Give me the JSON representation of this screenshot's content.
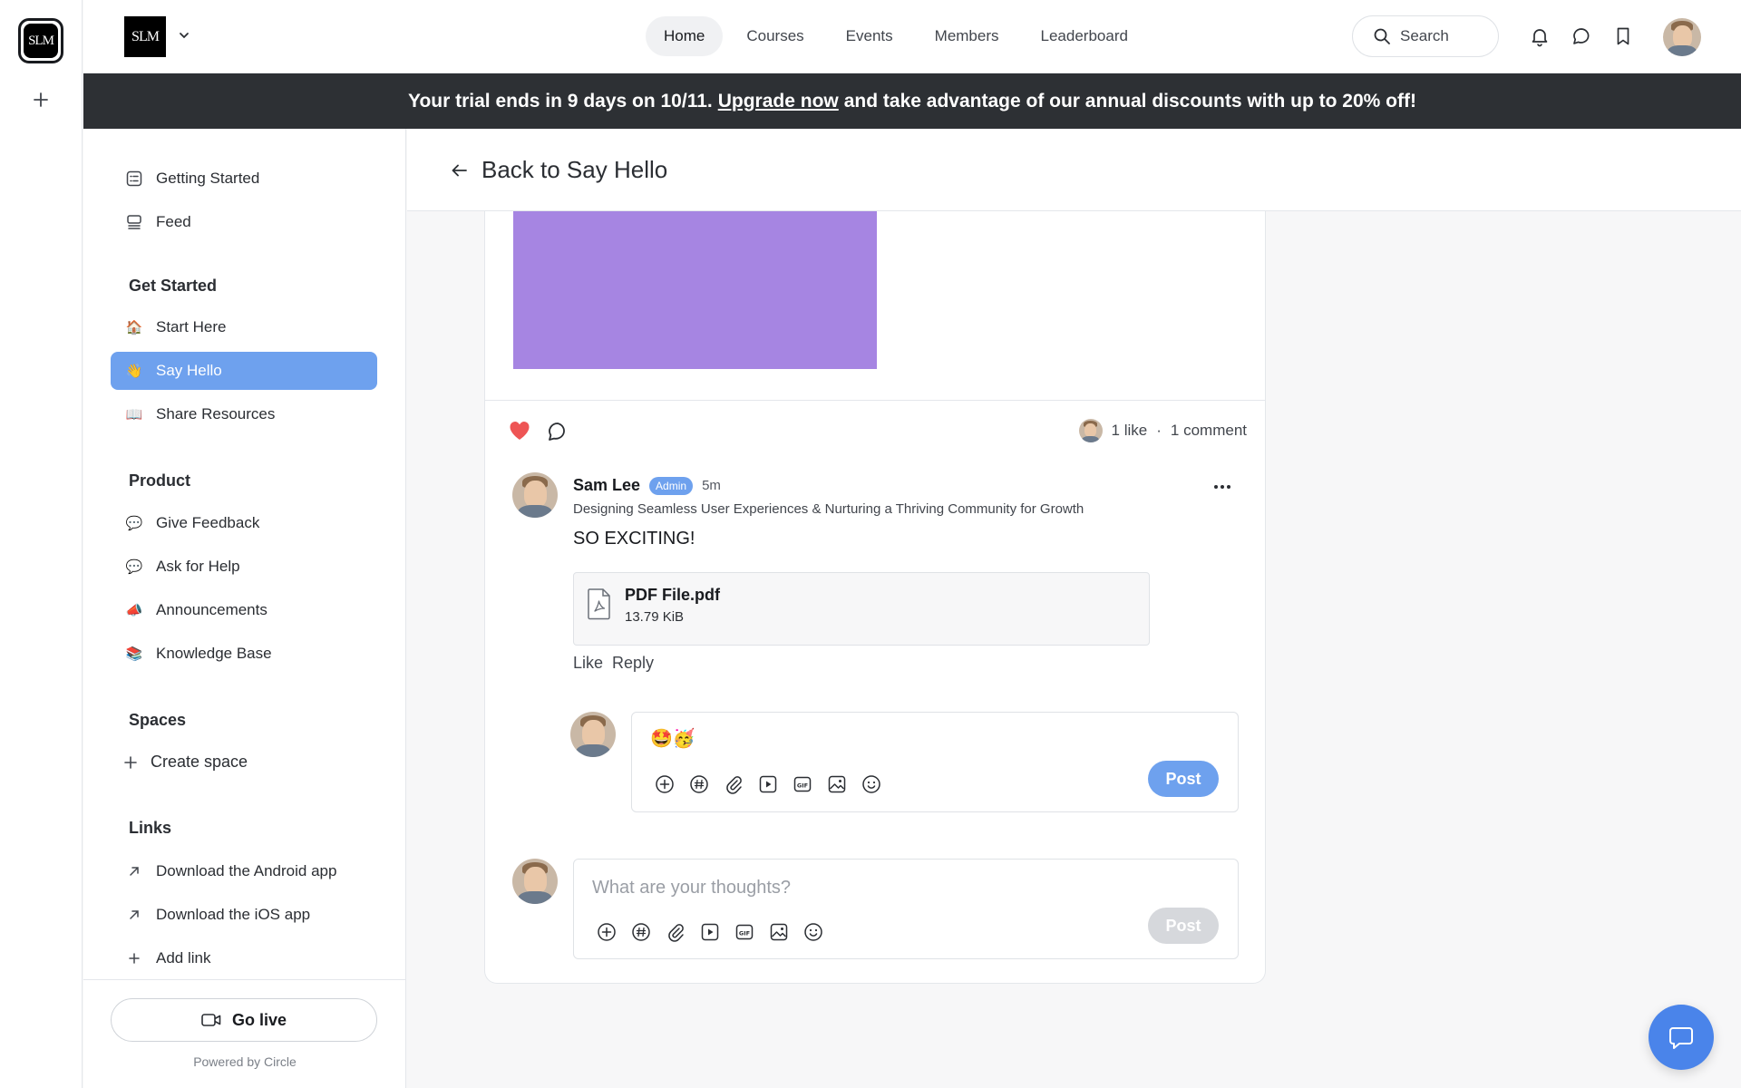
{
  "rail": {
    "community_initials": "SLM"
  },
  "header": {
    "logo_text": "SLM",
    "nav": [
      "Home",
      "Courses",
      "Events",
      "Members",
      "Leaderboard"
    ],
    "active_nav": "Home",
    "search_label": "Search"
  },
  "banner": {
    "before": "Your trial ends in 9 days on 10/11.",
    "link": "Upgrade now",
    "after": "and take advantage of our annual discounts with up to 20% off!"
  },
  "sidebar": {
    "top_items": [
      {
        "label": "Getting Started",
        "icon": "checklist-icon"
      },
      {
        "label": "Feed",
        "icon": "feed-icon"
      }
    ],
    "sections": [
      {
        "heading": "Get Started",
        "items": [
          {
            "label": "Start Here",
            "emoji": "🏠"
          },
          {
            "label": "Say Hello",
            "emoji": "👋",
            "active": true
          },
          {
            "label": "Share Resources",
            "emoji": "📖"
          }
        ]
      },
      {
        "heading": "Product",
        "items": [
          {
            "label": "Give Feedback",
            "emoji": "💬"
          },
          {
            "label": "Ask for Help",
            "emoji": "💬"
          },
          {
            "label": "Announcements",
            "emoji": "📣"
          },
          {
            "label": "Knowledge Base",
            "emoji": "📚"
          }
        ]
      }
    ],
    "spaces_heading": "Spaces",
    "create_space": "Create space",
    "links_heading": "Links",
    "links": [
      "Download the Android app",
      "Download the iOS app"
    ],
    "add_link": "Add link",
    "go_live": "Go live",
    "powered_by": "Powered by Circle"
  },
  "main": {
    "back_label": "Back to Say Hello",
    "post": {
      "likes_text": "1 like",
      "separator": "·",
      "comments_text": "1 comment"
    },
    "comment": {
      "author": "Sam Lee",
      "badge": "Admin",
      "time": "5m",
      "headline": "Designing Seamless User Experiences & Nurturing a Thriving Community for Growth",
      "body": "SO EXCITING!",
      "attachment": {
        "name": "PDF File.pdf",
        "size": "13.79 KiB"
      },
      "like_label": "Like",
      "reply_label": "Reply"
    },
    "reply": {
      "draft": "🤩🥳",
      "post_label": "Post"
    },
    "new_comment": {
      "placeholder": "What are your thoughts?",
      "post_label": "Post"
    }
  },
  "colors": {
    "accent": "#6ea1ee",
    "banner": "#2d3034",
    "heart": "#ee5555",
    "fab": "#4a84ea",
    "post_image": "#a685e2"
  }
}
